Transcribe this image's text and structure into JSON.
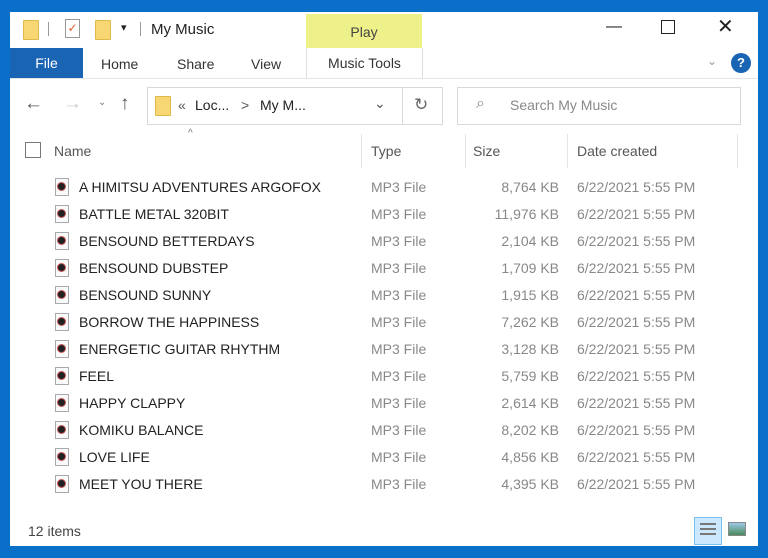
{
  "title": "My Music",
  "ribbon": {
    "play": "Play",
    "file": "File",
    "home": "Home",
    "share": "Share",
    "view": "View",
    "music_tools": "Music Tools"
  },
  "address": {
    "prefix": "«",
    "crumb1": "Loc...",
    "sep": ">",
    "crumb2": "My M..."
  },
  "search": {
    "placeholder": "Search My Music"
  },
  "columns": {
    "name": "Name",
    "type": "Type",
    "size": "Size",
    "date": "Date created"
  },
  "files": [
    {
      "name": "A HIMITSU ADVENTURES ARGOFOX",
      "type": "MP3 File",
      "size": "8,764 KB",
      "date": "6/22/2021 5:55 PM"
    },
    {
      "name": "BATTLE METAL 320BIT",
      "type": "MP3 File",
      "size": "11,976 KB",
      "date": "6/22/2021 5:55 PM"
    },
    {
      "name": "BENSOUND BETTERDAYS",
      "type": "MP3 File",
      "size": "2,104 KB",
      "date": "6/22/2021 5:55 PM"
    },
    {
      "name": "BENSOUND DUBSTEP",
      "type": "MP3 File",
      "size": "1,709 KB",
      "date": "6/22/2021 5:55 PM"
    },
    {
      "name": "BENSOUND SUNNY",
      "type": "MP3 File",
      "size": "1,915 KB",
      "date": "6/22/2021 5:55 PM"
    },
    {
      "name": "BORROW THE HAPPINESS",
      "type": "MP3 File",
      "size": "7,262 KB",
      "date": "6/22/2021 5:55 PM"
    },
    {
      "name": "ENERGETIC GUITAR RHYTHM",
      "type": "MP3 File",
      "size": "3,128 KB",
      "date": "6/22/2021 5:55 PM"
    },
    {
      "name": "FEEL",
      "type": "MP3 File",
      "size": "5,759 KB",
      "date": "6/22/2021 5:55 PM"
    },
    {
      "name": "HAPPY CLAPPY",
      "type": "MP3 File",
      "size": "2,614 KB",
      "date": "6/22/2021 5:55 PM"
    },
    {
      "name": "KOMIKU BALANCE",
      "type": "MP3 File",
      "size": "8,202 KB",
      "date": "6/22/2021 5:55 PM"
    },
    {
      "name": "LOVE LIFE",
      "type": "MP3 File",
      "size": "4,856 KB",
      "date": "6/22/2021 5:55 PM"
    },
    {
      "name": "MEET YOU THERE",
      "type": "MP3 File",
      "size": "4,395 KB",
      "date": "6/22/2021 5:55 PM"
    }
  ],
  "status": {
    "count": "12 items"
  }
}
